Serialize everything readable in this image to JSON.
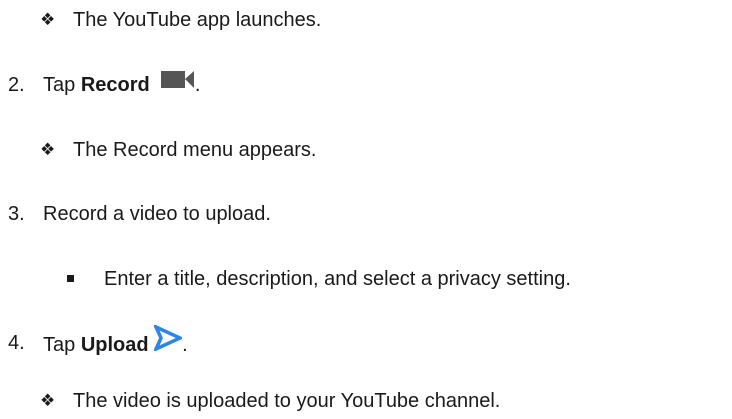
{
  "steps": {
    "s1_result": "The YouTube app launches.",
    "s2": {
      "number": "2.",
      "prefix": "Tap ",
      "bold": "Record",
      "icon": "video-camera-icon",
      "suffix": "."
    },
    "s2_result": "The Record menu appears.",
    "s3": {
      "number": "3.",
      "text": "Record a video to upload."
    },
    "s3_sub": "Enter a title, description, and select a privacy setting.",
    "s4": {
      "number": "4.",
      "prefix": "Tap ",
      "bold": "Upload",
      "icon": "send-arrow-icon",
      "suffix": "."
    },
    "s4_result": "The video is uploaded to your YouTube channel."
  },
  "bullets": {
    "diamond": "❖"
  },
  "colors": {
    "text": "#1a1a1a",
    "camera_icon": "#555555",
    "upload_icon": "#2a86e8"
  }
}
